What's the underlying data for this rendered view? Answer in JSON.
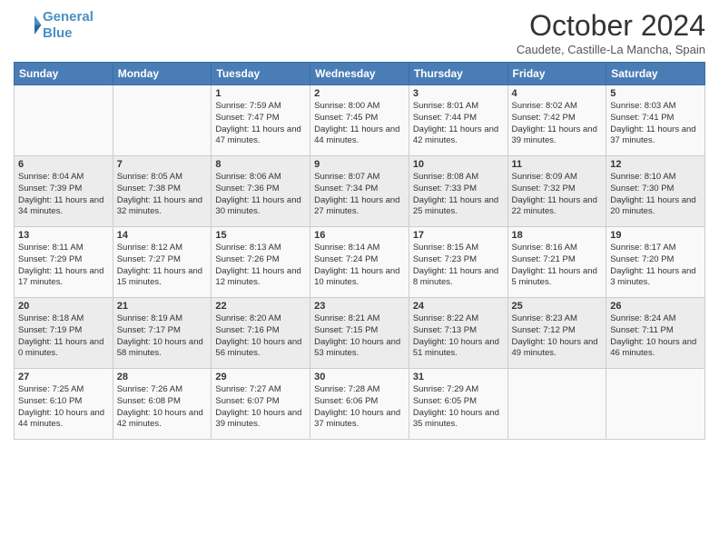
{
  "header": {
    "logo_line1": "General",
    "logo_line2": "Blue",
    "month": "October 2024",
    "subtitle": "Caudete, Castille-La Mancha, Spain"
  },
  "days_of_week": [
    "Sunday",
    "Monday",
    "Tuesday",
    "Wednesday",
    "Thursday",
    "Friday",
    "Saturday"
  ],
  "weeks": [
    [
      {
        "day": "",
        "content": ""
      },
      {
        "day": "",
        "content": ""
      },
      {
        "day": "1",
        "content": "Sunrise: 7:59 AM\nSunset: 7:47 PM\nDaylight: 11 hours and 47 minutes."
      },
      {
        "day": "2",
        "content": "Sunrise: 8:00 AM\nSunset: 7:45 PM\nDaylight: 11 hours and 44 minutes."
      },
      {
        "day": "3",
        "content": "Sunrise: 8:01 AM\nSunset: 7:44 PM\nDaylight: 11 hours and 42 minutes."
      },
      {
        "day": "4",
        "content": "Sunrise: 8:02 AM\nSunset: 7:42 PM\nDaylight: 11 hours and 39 minutes."
      },
      {
        "day": "5",
        "content": "Sunrise: 8:03 AM\nSunset: 7:41 PM\nDaylight: 11 hours and 37 minutes."
      }
    ],
    [
      {
        "day": "6",
        "content": "Sunrise: 8:04 AM\nSunset: 7:39 PM\nDaylight: 11 hours and 34 minutes."
      },
      {
        "day": "7",
        "content": "Sunrise: 8:05 AM\nSunset: 7:38 PM\nDaylight: 11 hours and 32 minutes."
      },
      {
        "day": "8",
        "content": "Sunrise: 8:06 AM\nSunset: 7:36 PM\nDaylight: 11 hours and 30 minutes."
      },
      {
        "day": "9",
        "content": "Sunrise: 8:07 AM\nSunset: 7:34 PM\nDaylight: 11 hours and 27 minutes."
      },
      {
        "day": "10",
        "content": "Sunrise: 8:08 AM\nSunset: 7:33 PM\nDaylight: 11 hours and 25 minutes."
      },
      {
        "day": "11",
        "content": "Sunrise: 8:09 AM\nSunset: 7:32 PM\nDaylight: 11 hours and 22 minutes."
      },
      {
        "day": "12",
        "content": "Sunrise: 8:10 AM\nSunset: 7:30 PM\nDaylight: 11 hours and 20 minutes."
      }
    ],
    [
      {
        "day": "13",
        "content": "Sunrise: 8:11 AM\nSunset: 7:29 PM\nDaylight: 11 hours and 17 minutes."
      },
      {
        "day": "14",
        "content": "Sunrise: 8:12 AM\nSunset: 7:27 PM\nDaylight: 11 hours and 15 minutes."
      },
      {
        "day": "15",
        "content": "Sunrise: 8:13 AM\nSunset: 7:26 PM\nDaylight: 11 hours and 12 minutes."
      },
      {
        "day": "16",
        "content": "Sunrise: 8:14 AM\nSunset: 7:24 PM\nDaylight: 11 hours and 10 minutes."
      },
      {
        "day": "17",
        "content": "Sunrise: 8:15 AM\nSunset: 7:23 PM\nDaylight: 11 hours and 8 minutes."
      },
      {
        "day": "18",
        "content": "Sunrise: 8:16 AM\nSunset: 7:21 PM\nDaylight: 11 hours and 5 minutes."
      },
      {
        "day": "19",
        "content": "Sunrise: 8:17 AM\nSunset: 7:20 PM\nDaylight: 11 hours and 3 minutes."
      }
    ],
    [
      {
        "day": "20",
        "content": "Sunrise: 8:18 AM\nSunset: 7:19 PM\nDaylight: 11 hours and 0 minutes."
      },
      {
        "day": "21",
        "content": "Sunrise: 8:19 AM\nSunset: 7:17 PM\nDaylight: 10 hours and 58 minutes."
      },
      {
        "day": "22",
        "content": "Sunrise: 8:20 AM\nSunset: 7:16 PM\nDaylight: 10 hours and 56 minutes."
      },
      {
        "day": "23",
        "content": "Sunrise: 8:21 AM\nSunset: 7:15 PM\nDaylight: 10 hours and 53 minutes."
      },
      {
        "day": "24",
        "content": "Sunrise: 8:22 AM\nSunset: 7:13 PM\nDaylight: 10 hours and 51 minutes."
      },
      {
        "day": "25",
        "content": "Sunrise: 8:23 AM\nSunset: 7:12 PM\nDaylight: 10 hours and 49 minutes."
      },
      {
        "day": "26",
        "content": "Sunrise: 8:24 AM\nSunset: 7:11 PM\nDaylight: 10 hours and 46 minutes."
      }
    ],
    [
      {
        "day": "27",
        "content": "Sunrise: 7:25 AM\nSunset: 6:10 PM\nDaylight: 10 hours and 44 minutes."
      },
      {
        "day": "28",
        "content": "Sunrise: 7:26 AM\nSunset: 6:08 PM\nDaylight: 10 hours and 42 minutes."
      },
      {
        "day": "29",
        "content": "Sunrise: 7:27 AM\nSunset: 6:07 PM\nDaylight: 10 hours and 39 minutes."
      },
      {
        "day": "30",
        "content": "Sunrise: 7:28 AM\nSunset: 6:06 PM\nDaylight: 10 hours and 37 minutes."
      },
      {
        "day": "31",
        "content": "Sunrise: 7:29 AM\nSunset: 6:05 PM\nDaylight: 10 hours and 35 minutes."
      },
      {
        "day": "",
        "content": ""
      },
      {
        "day": "",
        "content": ""
      }
    ]
  ]
}
